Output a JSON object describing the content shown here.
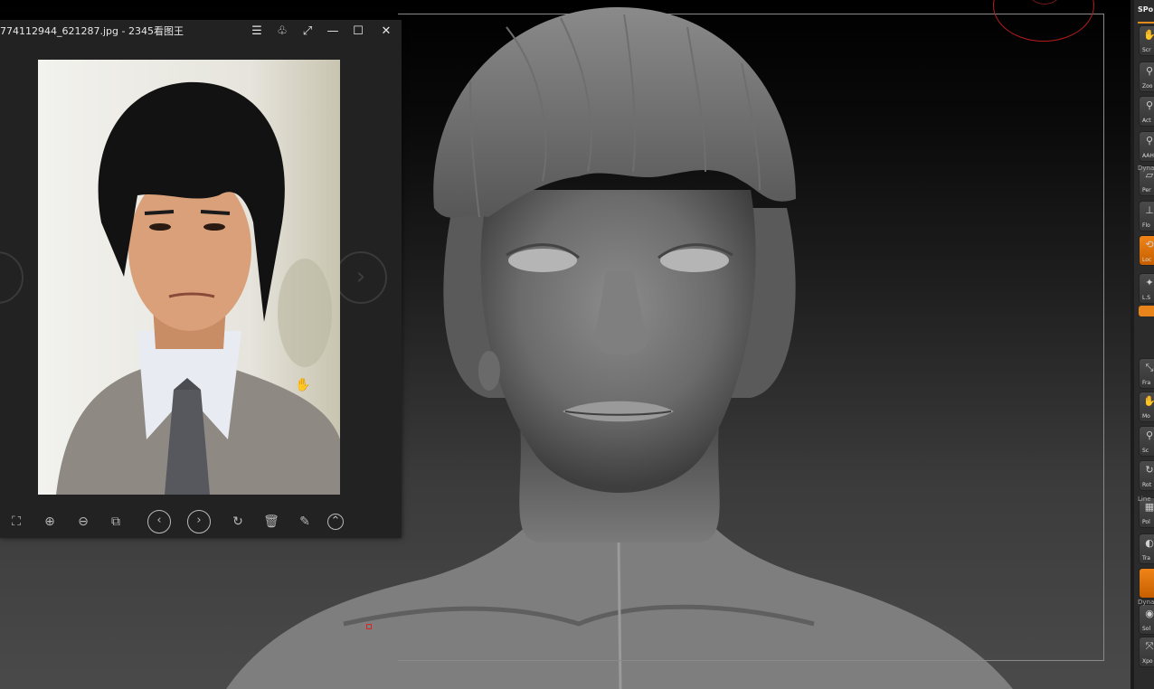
{
  "viewer": {
    "title": "774112944_621287.jpg - 2345看图王",
    "title_buttons": [
      {
        "name": "menu-button",
        "icon": "menu-icon",
        "glyph": "☰"
      },
      {
        "name": "skin-button",
        "icon": "shirt-icon",
        "glyph": "♧"
      },
      {
        "name": "fullscreen-button",
        "icon": "expand-icon",
        "glyph": "⤢"
      },
      {
        "name": "minimize-button",
        "icon": "minimize-icon",
        "glyph": "—"
      },
      {
        "name": "maximize-button",
        "icon": "maximize-icon",
        "glyph": "☐"
      },
      {
        "name": "close-button",
        "icon": "close-icon",
        "glyph": "✕"
      }
    ],
    "nav": {
      "prev_glyph": "‹",
      "next_glyph": "›"
    },
    "toolbar": [
      {
        "name": "fit-window-button",
        "icon": "fit-icon",
        "glyph": "⛶",
        "round": false
      },
      {
        "name": "zoom-in-button",
        "icon": "zoom-in-icon",
        "glyph": "⊕",
        "round": false
      },
      {
        "name": "zoom-out-button",
        "icon": "zoom-out-icon",
        "glyph": "⊖",
        "round": false
      },
      {
        "name": "actual-size-button",
        "icon": "image-icon",
        "glyph": "⧉",
        "round": false
      },
      {
        "name": "previous-button",
        "icon": "chevron-left-icon",
        "glyph": "‹",
        "round": true
      },
      {
        "name": "next-button",
        "icon": "chevron-right-icon",
        "glyph": "›",
        "round": true
      },
      {
        "name": "rotate-button",
        "icon": "rotate-icon",
        "glyph": "↻",
        "round": false
      },
      {
        "name": "delete-button",
        "icon": "trash-icon",
        "glyph": "🗑",
        "round": false
      },
      {
        "name": "edit-button",
        "icon": "edit-icon",
        "glyph": "✎",
        "round": false
      },
      {
        "name": "more-button",
        "icon": "chevron-up-icon",
        "glyph": "⌃",
        "round": true
      }
    ]
  },
  "shelf": {
    "header": "SPo",
    "buttons": [
      {
        "label": "Scr",
        "icon": "hand-icon",
        "glyph": "✋",
        "active": false
      },
      {
        "label": "Zoo",
        "icon": "zoom-icon",
        "glyph": "⚲",
        "active": false
      },
      {
        "label": "Act",
        "icon": "actual-icon",
        "glyph": "⚲",
        "active": false
      },
      {
        "label": "AAH",
        "icon": "aahalf-icon",
        "glyph": "⚲",
        "active": false
      },
      {
        "label": "Per",
        "icon": "persp-icon",
        "glyph": "▱",
        "active": false
      },
      {
        "label": "Flo",
        "icon": "floor-icon",
        "glyph": "⊥",
        "active": false
      },
      {
        "label": "Loc",
        "icon": "local-icon",
        "glyph": "⟲",
        "active": true
      },
      {
        "label": "L.S",
        "icon": "lsym-icon",
        "glyph": "✦",
        "active": false
      },
      {
        "label": "Fra",
        "icon": "frame-icon",
        "glyph": "⤡",
        "active": false
      },
      {
        "label": "Mo",
        "icon": "move-icon",
        "glyph": "✋",
        "active": false
      },
      {
        "label": "Sc",
        "icon": "scale-icon",
        "glyph": "⚲",
        "active": false
      },
      {
        "label": "Rot",
        "icon": "rotate-icon",
        "glyph": "↻",
        "active": false
      },
      {
        "label": "Pol",
        "icon": "polyf-icon",
        "glyph": "▦",
        "active": false
      },
      {
        "label": "Tra",
        "icon": "transp-icon",
        "glyph": "◐",
        "active": false
      },
      {
        "label": "",
        "icon": "ghost-icon",
        "glyph": "",
        "active": true
      },
      {
        "label": "Sol",
        "icon": "solo-icon",
        "glyph": "◉",
        "active": false
      },
      {
        "label": "Xpo",
        "icon": "xpose-icon",
        "glyph": "⤧",
        "active": false
      }
    ],
    "small_labels": [
      "Dyna",
      "Line",
      "Dyna"
    ]
  },
  "colors": {
    "accent": "#e8841a",
    "gizmo": "#b41d1d",
    "frame": "#8a8a8a"
  }
}
